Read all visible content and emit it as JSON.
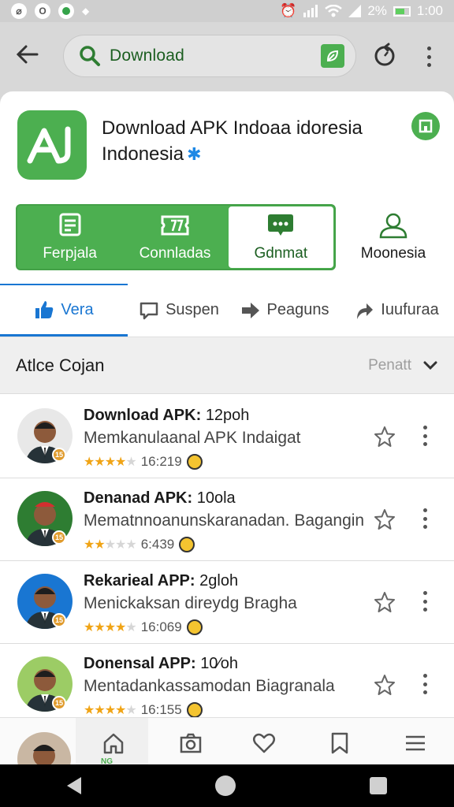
{
  "status": {
    "battery": "2%",
    "time": "1:00"
  },
  "search": {
    "query": "Download"
  },
  "app": {
    "title_line1": "Download APK Indoaa idoresia",
    "title_line2": "Indonesia"
  },
  "actions": [
    {
      "label": "Ferpjala",
      "icon": "document-icon"
    },
    {
      "label": "Connladas",
      "icon": "ticket-icon"
    },
    {
      "label": "Gdnmat",
      "icon": "chat-icon",
      "selected": true
    }
  ],
  "action_extra": {
    "label": "Moonesia",
    "icon": "person-icon"
  },
  "tabs": [
    {
      "label": "Vera",
      "icon": "thumbs-up-icon",
      "active": true
    },
    {
      "label": "Suspen",
      "icon": "comment-icon"
    },
    {
      "label": "Peaguns",
      "icon": "forward-icon"
    },
    {
      "label": "Iuufuraa",
      "icon": "share-icon"
    }
  ],
  "section": {
    "title": "Atlce Cojan",
    "sort_label": "Penatt"
  },
  "items": [
    {
      "title": "Download APK:",
      "size": "12poh",
      "desc": "Memkanulaanal APK Indaigat",
      "rating": 4,
      "count": "16:219",
      "avatar_bg": "#e8e8e8",
      "cap": ""
    },
    {
      "title": "Denanad APK:",
      "size": "10ola",
      "desc": "Mematnnoanunskaranadan. Bagangin",
      "rating": 2,
      "count": "6:439",
      "avatar_bg": "#2e7d32",
      "cap": "#d32f2f"
    },
    {
      "title": "Rekarieal APP:",
      "size": "2gloh",
      "desc": "Menickaksan direydg Bragha",
      "rating": 4,
      "count": "16:069",
      "avatar_bg": "#1976d2",
      "cap": ""
    },
    {
      "title": "Donensal APP:",
      "size": "10∕oh",
      "desc": "Mentadankassamodan Biagranala",
      "rating": 4,
      "count": "16:155",
      "avatar_bg": "#9ccc65",
      "cap": ""
    }
  ],
  "bottom_nav": {
    "home_label": "NG"
  },
  "colors": {
    "brand_green": "#4caf50",
    "accent_blue": "#1976d2",
    "star": "#f0a416"
  }
}
